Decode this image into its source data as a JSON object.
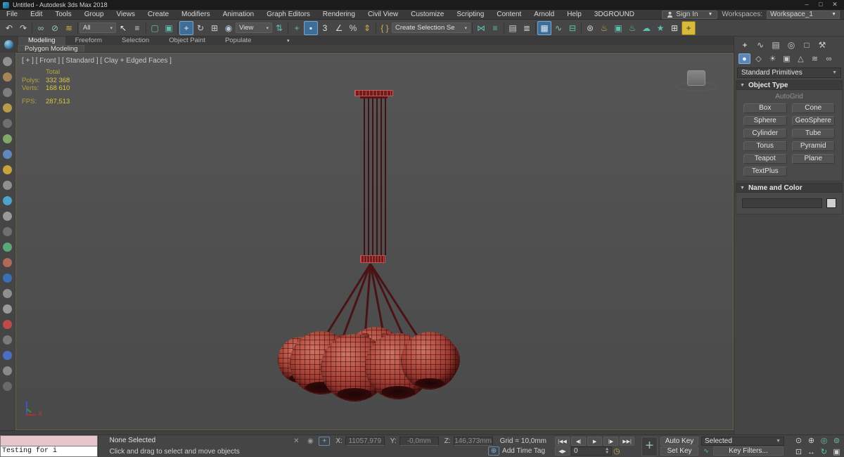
{
  "titlebar": {
    "title": "Untitled - Autodesk 3ds Max 2018",
    "minimize": "–",
    "maximize": "□",
    "close": "✕"
  },
  "menubar": {
    "items": [
      {
        "label": "File"
      },
      {
        "label": "Edit"
      },
      {
        "label": "Tools"
      },
      {
        "label": "Group"
      },
      {
        "label": "Views"
      },
      {
        "label": "Create"
      },
      {
        "label": "Modifiers"
      },
      {
        "label": "Animation"
      },
      {
        "label": "Graph Editors"
      },
      {
        "label": "Rendering"
      },
      {
        "label": "Civil View"
      },
      {
        "label": "Customize"
      },
      {
        "label": "Scripting"
      },
      {
        "label": "Content"
      },
      {
        "label": "Arnold"
      },
      {
        "label": "Help"
      },
      {
        "label": "3DGROUND"
      }
    ],
    "signin_label": "Sign In",
    "workspaces_label": "Workspaces:",
    "workspace_value": "Workspace_1"
  },
  "toolbar": {
    "icons": [
      {
        "name": "undo-icon",
        "glyph": "↶",
        "color": "#cfcfcf"
      },
      {
        "name": "redo-icon",
        "glyph": "↷",
        "color": "#cfcfcf"
      },
      {
        "name": "separator",
        "sep": true
      },
      {
        "name": "select-and-link-icon",
        "glyph": "∞",
        "color": "#9fc3b4"
      },
      {
        "name": "unlink-selection-icon",
        "glyph": "⊘",
        "color": "#9fc3b4"
      },
      {
        "name": "bind-to-space-warp-icon",
        "glyph": "≋",
        "color": "#cdb04e"
      },
      {
        "name": "separator",
        "sep": true
      },
      {
        "name": "selection-filter-dropdown",
        "dd": "All",
        "drop": true
      },
      {
        "name": "select-object-icon",
        "glyph": "↖",
        "color": "#ececec"
      },
      {
        "name": "select-by-name-icon",
        "glyph": "≡",
        "color": "#cfcfcf"
      },
      {
        "name": "separator",
        "sep": true
      },
      {
        "name": "rectangular-selection-region-icon",
        "glyph": "▢",
        "color": "#5fbfae"
      },
      {
        "name": "window-crossing-toggle-icon",
        "glyph": "▣",
        "color": "#5fbfae"
      },
      {
        "name": "separator",
        "sep": true
      },
      {
        "name": "select-and-move-icon",
        "glyph": "+",
        "color": "#eef4fa",
        "active": true
      },
      {
        "name": "select-and-rotate-icon",
        "glyph": "↻",
        "color": "#cfcfcf"
      },
      {
        "name": "select-and-scale-icon",
        "glyph": "⊞",
        "color": "#cfcfcf"
      },
      {
        "name": "select-and-place-icon",
        "glyph": "◉",
        "color": "#b8c8d8"
      },
      {
        "name": "reference-coordinate-system-dropdown",
        "dd": "View",
        "drop": true
      },
      {
        "name": "use-pivot-point-center-icon",
        "glyph": "⇅",
        "color": "#5fbfae"
      },
      {
        "name": "separator",
        "sep": true
      },
      {
        "name": "select-and-manipulate-icon",
        "glyph": "+",
        "color": "#5fbfae"
      },
      {
        "name": "keyboard-shortcut-override-icon",
        "glyph": "▪",
        "color": "#e8e8e8",
        "active": true
      },
      {
        "name": "snap-toggle-3d-icon",
        "glyph": "3",
        "color": "#e0e0e0"
      },
      {
        "name": "angle-snap-toggle-icon",
        "glyph": "∠",
        "color": "#cfcfcf"
      },
      {
        "name": "percent-snap-toggle-icon",
        "glyph": "%",
        "color": "#cfcfcf"
      },
      {
        "name": "spinner-snap-toggle-icon",
        "glyph": "⇕",
        "color": "#cdb04e"
      },
      {
        "name": "separator",
        "sep": true
      },
      {
        "name": "edit-named-selection-sets-icon",
        "glyph": "{ }",
        "color": "#cdb04e"
      },
      {
        "name": "named-selection-sets-dropdown",
        "dd": "Create Selection Se",
        "drop": true,
        "wide": true
      },
      {
        "name": "separator",
        "sep": true
      },
      {
        "name": "mirror-icon",
        "glyph": "⋈",
        "color": "#5fbfae"
      },
      {
        "name": "align-icon",
        "glyph": "≡",
        "color": "#5fbfae"
      },
      {
        "name": "separator",
        "sep": true
      },
      {
        "name": "scene-explorer-icon",
        "glyph": "▤",
        "color": "#cfcfcf"
      },
      {
        "name": "layer-explorer-icon",
        "glyph": "≣",
        "color": "#cfcfcf"
      },
      {
        "name": "separator",
        "sep": true
      },
      {
        "name": "toggle-ribbon-icon",
        "glyph": "▦",
        "color": "#dfe8f2",
        "active": true
      },
      {
        "name": "curve-editor-icon",
        "glyph": "∿",
        "color": "#7fc8a8"
      },
      {
        "name": "schematic-view-icon",
        "glyph": "⊟",
        "color": "#5fbfae"
      },
      {
        "name": "separator",
        "sep": true
      },
      {
        "name": "material-editor-icon",
        "glyph": "⊛",
        "color": "#cfcfcf"
      },
      {
        "name": "render-setup-icon",
        "glyph": "♨",
        "color": "#cdb04e"
      },
      {
        "name": "rendered-frame-window-icon",
        "glyph": "▣",
        "color": "#5fbfae"
      },
      {
        "name": "render-production-icon",
        "glyph": "♨",
        "color": "#5fbfae"
      },
      {
        "name": "render-in-cloud-icon",
        "glyph": "☁",
        "color": "#5fbfae"
      },
      {
        "name": "open-gallery-icon",
        "glyph": "★",
        "color": "#5fbfae"
      },
      {
        "name": "plugin-grid-icon",
        "glyph": "⊞",
        "color": "#e0e0e0"
      },
      {
        "name": "plugin-add-icon",
        "glyph": "+",
        "color": "#3a3a1a",
        "yellow": true
      }
    ]
  },
  "ribbon": {
    "tabs": [
      {
        "label": "Modeling",
        "active": true
      },
      {
        "label": "Freeform"
      },
      {
        "label": "Selection"
      },
      {
        "label": "Object Paint"
      },
      {
        "label": "Populate"
      }
    ],
    "panel_label": "Polygon Modeling"
  },
  "left_strip": {
    "icons": [
      {
        "name": "ribbon-vertical-tool-icon",
        "color": "#8f8f8f"
      },
      {
        "name": "ribbon-vertical-tool-icon",
        "color": "#a8835a"
      },
      {
        "name": "ribbon-vertical-tool-icon",
        "color": "#7d7d7d"
      },
      {
        "name": "ribbon-vertical-tool-icon",
        "color": "#b89a4a"
      },
      {
        "name": "ribbon-vertical-tool-icon",
        "color": "#6f6f6f"
      },
      {
        "name": "ribbon-vertical-tool-icon",
        "color": "#7fa86a"
      },
      {
        "name": "ribbon-vertical-tool-icon",
        "color": "#5f87c0"
      },
      {
        "name": "ribbon-vertical-tool-icon",
        "color": "#c8a23a"
      },
      {
        "name": "ribbon-vertical-tool-icon",
        "color": "#8f8f8f"
      },
      {
        "name": "ribbon-vertical-tool-icon",
        "color": "#4fa3c8"
      },
      {
        "name": "ribbon-vertical-tool-icon",
        "color": "#9a9a9a"
      },
      {
        "name": "ribbon-vertical-tool-icon",
        "color": "#6f6f6f"
      },
      {
        "name": "ribbon-vertical-tool-icon",
        "color": "#5aa87a"
      },
      {
        "name": "ribbon-vertical-tool-icon",
        "color": "#b06a5a"
      },
      {
        "name": "ribbon-vertical-tool-icon",
        "color": "#3a6fb5"
      },
      {
        "name": "ribbon-vertical-tool-icon",
        "color": "#8f8f8f"
      },
      {
        "name": "ribbon-vertical-tool-icon",
        "color": "#9a9a9a"
      },
      {
        "name": "ribbon-vertical-tool-icon",
        "color": "#c04a4a"
      },
      {
        "name": "ribbon-vertical-tool-icon",
        "color": "#7a7a7a"
      },
      {
        "name": "ribbon-vertical-tool-icon",
        "color": "#4a6fc0"
      },
      {
        "name": "ribbon-vertical-tool-icon",
        "color": "#8a8a8a"
      },
      {
        "name": "ribbon-vertical-tool-icon",
        "color": "#6a6a6a"
      }
    ]
  },
  "viewport": {
    "label": "[ + ] [ Front ] [ Standard ] [ Clay + Edged Faces ]",
    "stats": {
      "total_label": "Total",
      "polys_label": "Polys:",
      "polys_value": "332 368",
      "verts_label": "Verts:",
      "verts_value": "168 610",
      "fps_label": "FPS:",
      "fps_value": "287,513"
    },
    "axis_x_label": "X",
    "model_colors": {
      "lamp_body": "#b04a3e",
      "wireframe": "#2d0606",
      "cord": "#431114"
    }
  },
  "command_panel": {
    "tabs": [
      {
        "name": "create-tab-icon",
        "glyph": "+",
        "active": true
      },
      {
        "name": "modify-tab-icon",
        "glyph": "∿"
      },
      {
        "name": "hierarchy-tab-icon",
        "glyph": "▤"
      },
      {
        "name": "motion-tab-icon",
        "glyph": "◎"
      },
      {
        "name": "display-tab-icon",
        "glyph": "□"
      },
      {
        "name": "utilities-tab-icon",
        "glyph": "⚒"
      }
    ],
    "categories": [
      {
        "name": "geometry-category-icon",
        "glyph": "●",
        "active": true
      },
      {
        "name": "shapes-category-icon",
        "glyph": "◇"
      },
      {
        "name": "lights-category-icon",
        "glyph": "☀"
      },
      {
        "name": "cameras-category-icon",
        "glyph": "▣"
      },
      {
        "name": "helpers-category-icon",
        "glyph": "△"
      },
      {
        "name": "space-warps-category-icon",
        "glyph": "≋"
      },
      {
        "name": "systems-category-icon",
        "glyph": "∞"
      }
    ],
    "category_dropdown_value": "Standard Primitives",
    "object_type_rollout": "Object Type",
    "autogrid_label": "AutoGrid",
    "object_buttons": [
      {
        "name": "box-button",
        "label": "Box"
      },
      {
        "name": "cone-button",
        "label": "Cone"
      },
      {
        "name": "sphere-button",
        "label": "Sphere"
      },
      {
        "name": "geosphere-button",
        "label": "GeoSphere"
      },
      {
        "name": "cylinder-button",
        "label": "Cylinder"
      },
      {
        "name": "tube-button",
        "label": "Tube"
      },
      {
        "name": "torus-button",
        "label": "Torus"
      },
      {
        "name": "pyramid-button",
        "label": "Pyramid"
      },
      {
        "name": "teapot-button",
        "label": "Teapot"
      },
      {
        "name": "plane-button",
        "label": "Plane"
      },
      {
        "name": "textplus-button",
        "label": "TextPlus"
      }
    ],
    "name_color_rollout": "Name and Color"
  },
  "statusbar": {
    "listener_text": "Testing for i",
    "status_line": "None Selected",
    "prompt_line": "Click and drag to select and move objects",
    "x_label": "X:",
    "x_value": "11057,979",
    "y_label": "Y:",
    "y_value": "-0,0mm",
    "z_label": "Z:",
    "z_value": "146,373mm",
    "grid_text": "Grid = 10,0mm",
    "add_time_tag": "Add Time Tag",
    "playback": [
      {
        "name": "go-to-start-button",
        "glyph": "|◀◀"
      },
      {
        "name": "previous-frame-button",
        "glyph": "◀|"
      },
      {
        "name": "play-button",
        "glyph": "▶"
      },
      {
        "name": "next-frame-button",
        "glyph": "|▶"
      },
      {
        "name": "go-to-end-button",
        "glyph": "▶▶|"
      }
    ],
    "key_mode_glyph": "◀▶",
    "frame_value": "0",
    "auto_key": "Auto Key",
    "set_key": "Set Key",
    "selected_dropdown": "Selected",
    "key_filters": "Key Filters...",
    "nav_icons": [
      {
        "name": "zoom-icon",
        "glyph": "⊙"
      },
      {
        "name": "zoom-all-icon",
        "glyph": "⊕"
      },
      {
        "name": "zoom-extents-icon",
        "glyph": "◎",
        "teal": true
      },
      {
        "name": "zoom-extents-all-icon",
        "glyph": "⊚",
        "teal": true
      },
      {
        "name": "zoom-region-icon",
        "glyph": "⊡"
      },
      {
        "name": "pan-icon",
        "glyph": "↔"
      },
      {
        "name": "orbit-icon",
        "glyph": "↻",
        "teal": true
      },
      {
        "name": "maximize-viewport-icon",
        "glyph": "▣"
      }
    ]
  }
}
